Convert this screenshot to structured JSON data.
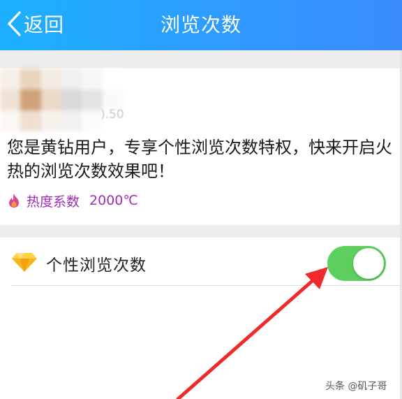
{
  "header": {
    "back_label": "返回",
    "title": "浏览次数"
  },
  "card": {
    "blurred_fragment": ").50",
    "description": "您是黄钻用户，专享个性浏览次数特权，快来开启火热的浏览次数效果吧！",
    "heat_label": "热度系数",
    "heat_value": "2000℃"
  },
  "setting": {
    "label": "个性浏览次数",
    "toggle_on": true
  },
  "watermark": "头条 @矶子哥",
  "colors": {
    "header_start": "#1bb0ff",
    "header_end": "#3a8cff",
    "toggle_on": "#5ccf5e",
    "heat_text": "#a02cb8",
    "annotation_arrow": "#ee2a2a"
  },
  "icons": {
    "back": "chevron-left-icon",
    "flame": "flame-icon",
    "diamond": "diamond-icon"
  }
}
